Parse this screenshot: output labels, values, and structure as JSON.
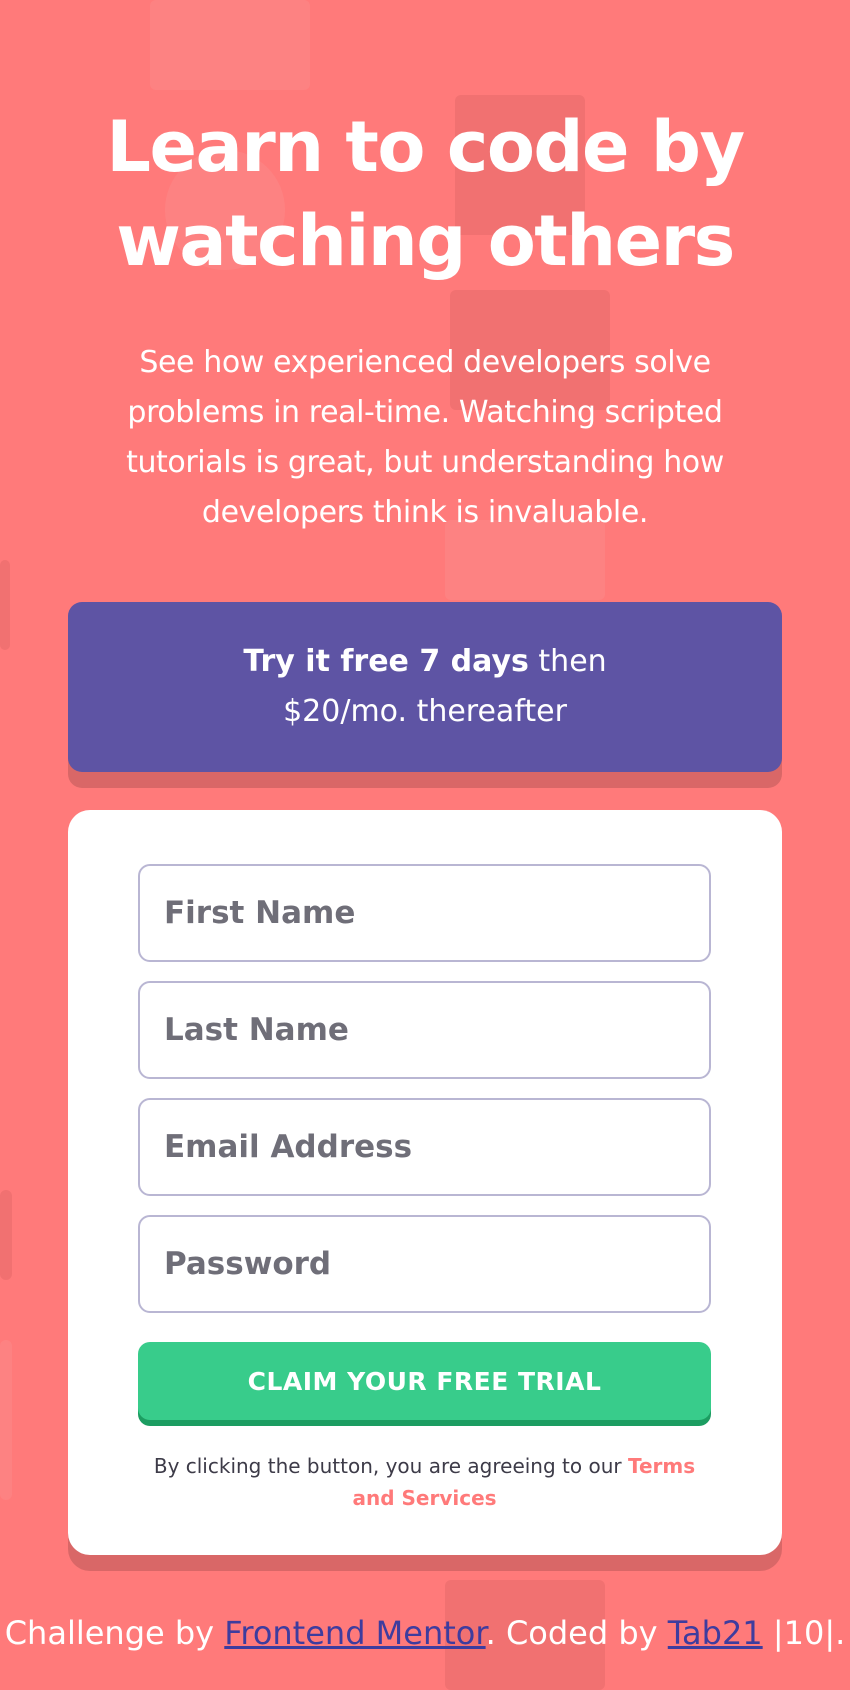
{
  "hero": {
    "title": "Learn to code by watching others",
    "description": "See how experienced developers solve problems in real-time. Watching scripted tutorials is great, but understanding how developers think is invaluable."
  },
  "promo": {
    "bold": "Try it free 7 days",
    "rest": " then $20/mo. thereafter"
  },
  "form": {
    "first_name_placeholder": "First Name",
    "last_name_placeholder": "Last Name",
    "email_placeholder": "Email Address",
    "password_placeholder": "Password",
    "submit_label": "CLAIM YOUR FREE TRIAL",
    "terms_prefix": "By clicking the button, you are agreeing to our ",
    "terms_link": "Terms and Services"
  },
  "attribution": {
    "prefix": "Challenge by ",
    "challenge_link": "Frontend Mentor",
    "middle": ". Coded by ",
    "author_link": "Tab21",
    "suffix": " |10|."
  },
  "colors": {
    "background": "#ff7a7a",
    "promo": "#5e54a4",
    "cta": "#38cc8b",
    "link": "#3e3c9e"
  }
}
